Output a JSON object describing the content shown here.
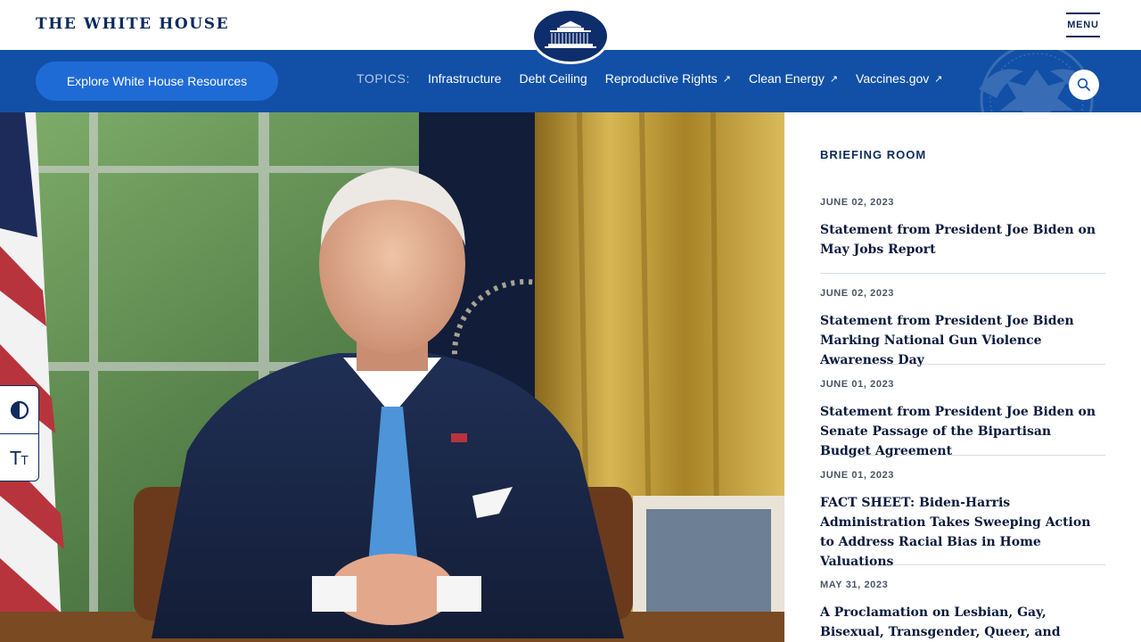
{
  "header": {
    "site_title": "THE WHITE HOUSE",
    "menu_label": "MENU"
  },
  "nav": {
    "explore_label": "Explore White House Resources",
    "topics_label": "TOPICS:",
    "topics": [
      {
        "label": "Infrastructure",
        "external": false
      },
      {
        "label": "Debt Ceiling",
        "external": false
      },
      {
        "label": "Reproductive Rights",
        "external": true
      },
      {
        "label": "Clean Energy",
        "external": true
      },
      {
        "label": "Vaccines.gov",
        "external": true
      }
    ],
    "external_glyph": "↗",
    "search_icon": "search-icon"
  },
  "accessibility": {
    "contrast_icon": "contrast-icon",
    "text_size_glyph": "T",
    "text_size_glyph_small": "T"
  },
  "briefing": {
    "heading": "BRIEFING ROOM",
    "items": [
      {
        "date": "JUNE 02, 2023",
        "title": "Statement from President Joe Biden on May Jobs Report"
      },
      {
        "date": "JUNE 02, 2023",
        "title": "Statement from President Joe Biden Marking National Gun Violence Awareness Day"
      },
      {
        "date": "JUNE 01, 2023",
        "title": "Statement from President Joe Biden on Senate Passage of the Bipartisan Budget Agreement"
      },
      {
        "date": "JUNE 01, 2023",
        "title": "FACT SHEET: Biden-Harris Administration Takes Sweeping Action to Address Racial Bias in Home Valuations"
      },
      {
        "date": "MAY 31, 2023",
        "title": "A Proclamation on Lesbian, Gay, Bisexual, Transgender, Queer, and Intersex Pride"
      }
    ]
  },
  "colors": {
    "navy": "#0c2a5c",
    "nav_blue": "#1150a6",
    "button_blue": "#1f6bd6"
  }
}
